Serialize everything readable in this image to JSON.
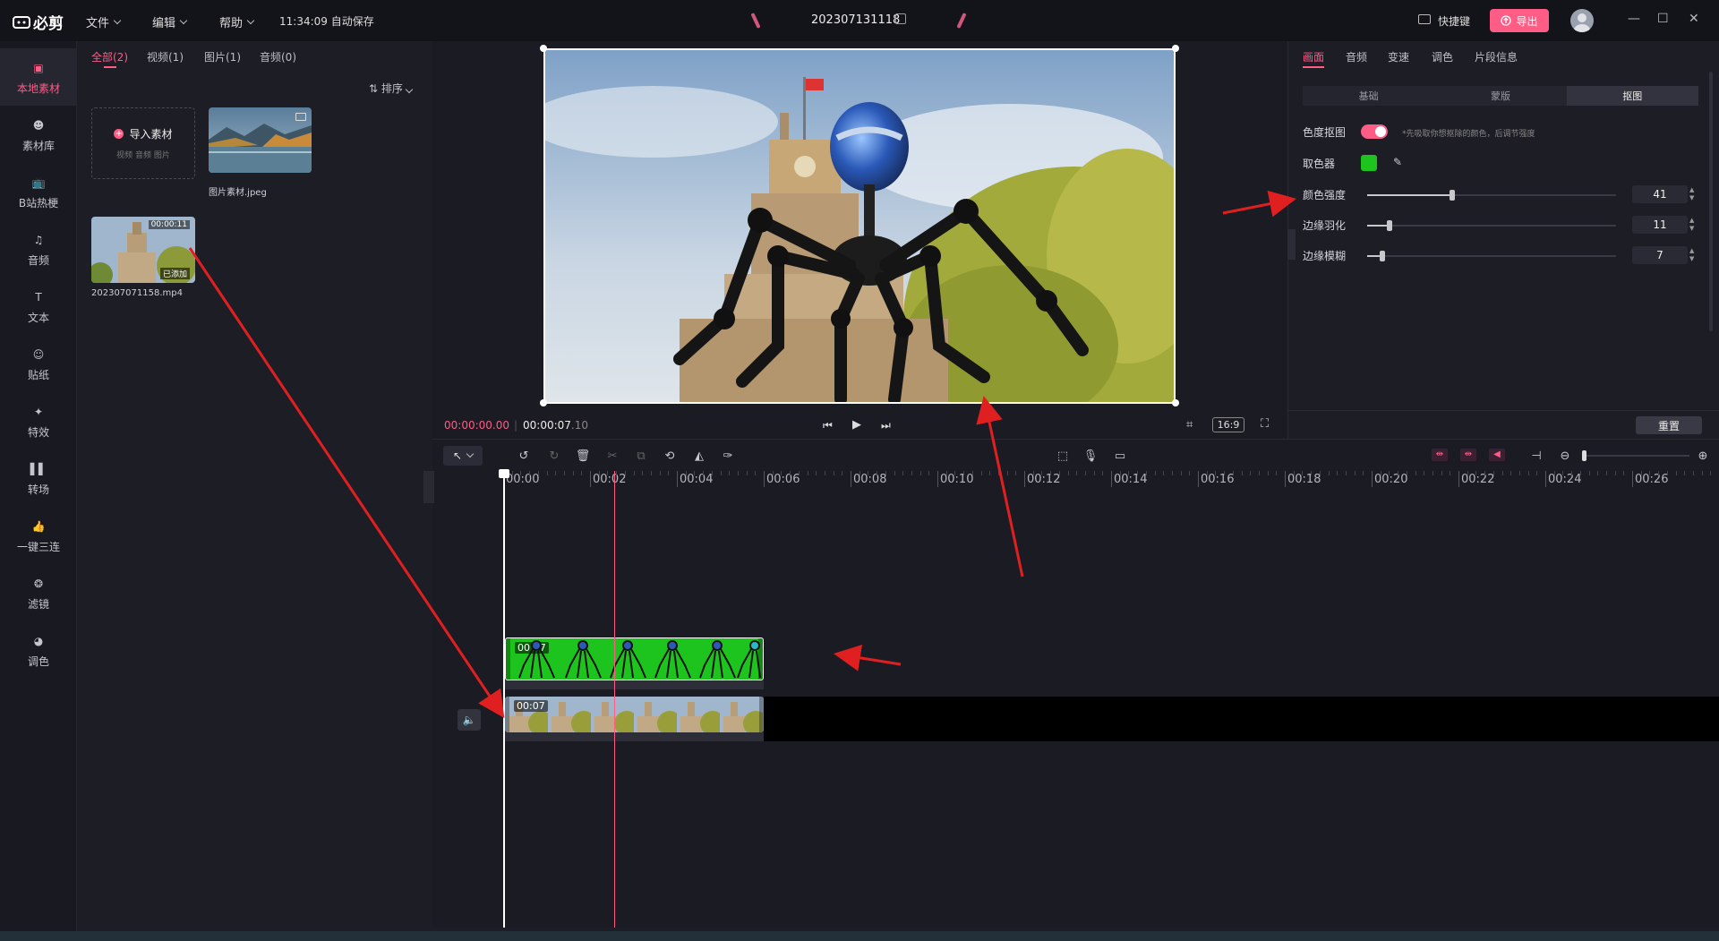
{
  "titlebar": {
    "app_name": "必剪",
    "menus": [
      "文件",
      "编辑",
      "帮助"
    ],
    "autosave": "11:34:09 自动保存",
    "project_name": "202307131118",
    "shortcut_label": "快捷键",
    "export_label": "导出"
  },
  "nav": [
    {
      "label": "本地素材",
      "icon": "folder-icon",
      "active": true
    },
    {
      "label": "素材库",
      "icon": "material-library-icon"
    },
    {
      "label": "B站热梗",
      "icon": "bilibili-icon"
    },
    {
      "label": "音频",
      "icon": "music-note-icon"
    },
    {
      "label": "文本",
      "icon": "text-icon"
    },
    {
      "label": "贴纸",
      "icon": "sticker-icon"
    },
    {
      "label": "特效",
      "icon": "effects-icon"
    },
    {
      "label": "转场",
      "icon": "transition-icon"
    },
    {
      "label": "一键三连",
      "icon": "thumbs-up-icon"
    },
    {
      "label": "滤镜",
      "icon": "filter-icon"
    },
    {
      "label": "调色",
      "icon": "palette-icon"
    }
  ],
  "media": {
    "tabs": [
      "全部(2)",
      "视频(1)",
      "图片(1)",
      "音频(0)"
    ],
    "sort_label": "排序",
    "import_label": "导入素材",
    "import_hint": "视频  音频  图片",
    "items": [
      {
        "name": "图片素材.jpeg"
      },
      {
        "name": "202307071158.mp4",
        "duration": "00:00:11",
        "badge": "已添加"
      }
    ]
  },
  "preview": {
    "current_time": "00:00:00.00",
    "total_time": "00:00:07",
    "total_time_frac": ".10",
    "aspect": "16:9"
  },
  "props": {
    "tabs": [
      "画面",
      "音频",
      "变速",
      "调色",
      "片段信息"
    ],
    "segments": [
      "基础",
      "蒙版",
      "抠图"
    ],
    "chroma_label": "色度抠图",
    "chroma_hint": "*先吸取你想抠除的颜色，后调节强度",
    "picker_label": "取色器",
    "picked_color": "#1ec41e",
    "sliders": [
      {
        "label": "颜色强度",
        "value": "41",
        "fraction": 0.34
      },
      {
        "label": "边缘羽化",
        "value": "11",
        "fraction": 0.09
      },
      {
        "label": "边缘模糊",
        "value": "7",
        "fraction": 0.06
      }
    ],
    "reset_label": "重置"
  },
  "timeline": {
    "ticks": [
      "00:00",
      "00:02",
      "00:04",
      "00:06",
      "00:08",
      "00:10",
      "00:12",
      "00:14",
      "00:16",
      "00:18",
      "00:20",
      "00:22",
      "00:24",
      "00:26"
    ],
    "overlay_clip_label": "00:07",
    "main_clip_label": "00:07"
  },
  "colors": {
    "accent": "#ff5c86",
    "green": "#1ec41e"
  }
}
